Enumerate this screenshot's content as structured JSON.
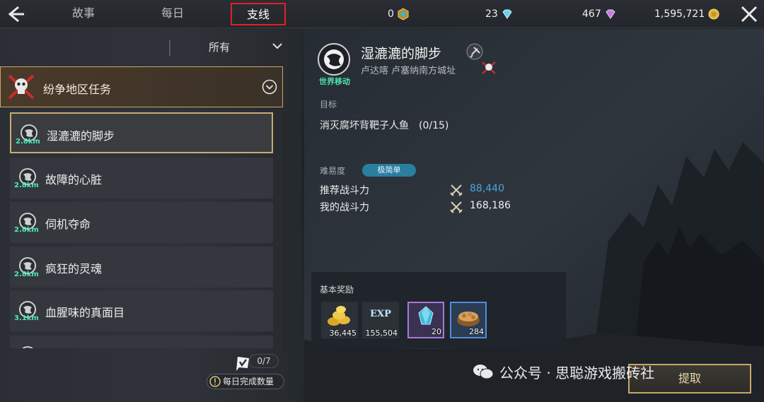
{
  "header": {
    "tabs": [
      {
        "label": "故事"
      },
      {
        "label": "每日"
      },
      {
        "label": "支线"
      }
    ],
    "active_tab": "支线",
    "currencies": [
      {
        "value": "0",
        "icon": "emblem-coin-icon"
      },
      {
        "value": "23",
        "icon": "blue-diamond-icon"
      },
      {
        "value": "467",
        "icon": "purple-diamond-icon"
      },
      {
        "value": "1,595,721",
        "icon": "gold-coin-icon"
      }
    ]
  },
  "sidebar": {
    "filter": {
      "selected": "所有"
    },
    "category": {
      "label": "纷争地区任务"
    },
    "quests": [
      {
        "distance": "2.8km",
        "name": "湿漉漉的脚步"
      },
      {
        "distance": "2.8km",
        "name": "故障的心脏"
      },
      {
        "distance": "2.8km",
        "name": "伺机夺命"
      },
      {
        "distance": "2.8km",
        "name": "疯狂的灵魂"
      },
      {
        "distance": "3.1km",
        "name": "血腥味的真面目"
      }
    ],
    "daily_count": "0/7",
    "daily_label": "每日完成数量"
  },
  "detail": {
    "world_move_label": "世界移动",
    "title": "湿漉漉的脚步",
    "location": "卢达喀 卢塞纳南方城址",
    "goal_heading": "目标",
    "goal_text": "消灭腐坏背靶子人鱼　(0/15)",
    "difficulty_heading": "难易度",
    "difficulty_value": "极简单",
    "recommended_cp_label": "推荐战斗力",
    "recommended_cp_value": "88,440",
    "my_cp_label": "我的战斗力",
    "my_cp_value": "168,186",
    "reward_heading": "基本奖励",
    "rewards": [
      {
        "kind": "gold-coins-icon",
        "qty": "36,445"
      },
      {
        "kind": "exp",
        "label": "EXP",
        "qty": "155,504"
      },
      {
        "kind": "crystal-icon",
        "qty": "20"
      },
      {
        "kind": "nuts-bowl-icon",
        "qty": "284"
      }
    ],
    "claim_label": "提取"
  },
  "watermark": "公众号 · 思聪游戏搬砖社",
  "colors": {
    "accent_gold": "#c9a762",
    "highlight_red": "#e52020",
    "distance_green": "#53e6b6",
    "recommended_cp_blue": "#4aa3e0",
    "difficulty_badge": "#2a7ea0"
  }
}
